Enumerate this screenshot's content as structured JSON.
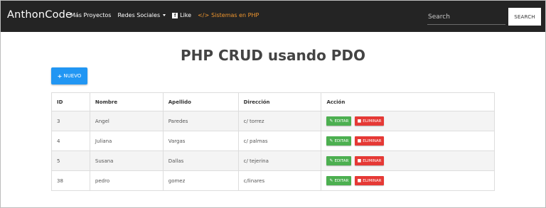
{
  "navbar": {
    "brand": "AnthonCode",
    "links": [
      {
        "label": "Más Proyectos"
      },
      {
        "label": "Redes Sociales"
      },
      {
        "label": "Like"
      },
      {
        "label": "Sistemas en PHP"
      }
    ],
    "search_placeholder": "Search",
    "search_button": "SEARCH"
  },
  "page": {
    "title": "PHP CRUD usando PDO",
    "new_button": "NUEVO"
  },
  "table": {
    "headers": [
      "ID",
      "Nombre",
      "Apellido",
      "Dirección",
      "Acción"
    ],
    "rows": [
      {
        "id": "3",
        "nombre": "Angel",
        "apellido": "Paredes",
        "direccion": "c/ torrez"
      },
      {
        "id": "4",
        "nombre": "Juliana",
        "apellido": "Vargas",
        "direccion": "c/ palmas"
      },
      {
        "id": "5",
        "nombre": "Susana",
        "apellido": "Dallas",
        "direccion": "c/ tejerina"
      },
      {
        "id": "38",
        "nombre": "pedro",
        "apellido": "gomez",
        "direccion": "c/linares"
      }
    ],
    "edit_label": "EDITAR",
    "delete_label": "ELIMINAR"
  },
  "colors": {
    "navbar_bg": "#242424",
    "accent_link": "#f0962e",
    "primary": "#2196f3",
    "success": "#4caf50",
    "danger": "#e53935"
  }
}
